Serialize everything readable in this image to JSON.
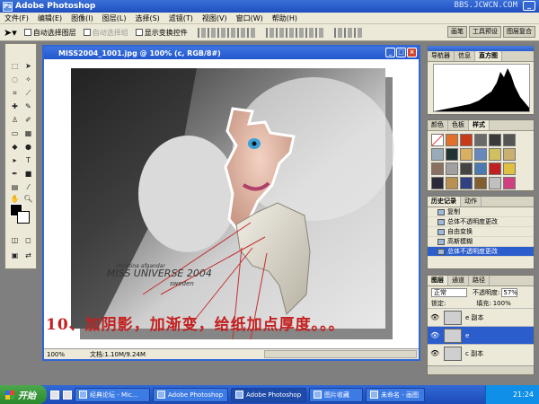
{
  "app": {
    "title": "Adobe Photoshop",
    "watermark": "BBS.JCWCN.COM"
  },
  "menu": [
    "文件(F)",
    "编辑(E)",
    "图像(I)",
    "图层(L)",
    "选择(S)",
    "滤镜(T)",
    "视图(V)",
    "窗口(W)",
    "帮助(H)"
  ],
  "options": {
    "auto_select_layer": "自动选择图层",
    "auto_select_group": "自动选择组",
    "show_transform": "显示变换控件",
    "palette_tabs": [
      "画笔",
      "工具预设",
      "图层复合"
    ]
  },
  "document": {
    "title": "MISS2004_1001.jpg @ 100% (c, RGB/8#)",
    "zoom": "100%",
    "doc_size": "文档:1.10M/9.24M",
    "caption": "10、加阴影，加渐变，给纸加点厚度。。。",
    "image_text_line1": "MISS UNIVERSE 2004",
    "image_text_line2": "sweden"
  },
  "panels": {
    "histogram": {
      "tabs": [
        "导航器",
        "信息",
        "直方图"
      ]
    },
    "styles": {
      "tabs": [
        "颜色",
        "色板",
        "样式"
      ]
    },
    "history": {
      "tabs": [
        "历史记录",
        "动作"
      ],
      "items": [
        "复制",
        "总体不透明度更改",
        "自由变换",
        "高斯模糊",
        "总体不透明度更改"
      ],
      "selected": 4
    },
    "layers": {
      "tabs": [
        "图层",
        "通道",
        "路径"
      ],
      "blend_mode": "正常",
      "opacity_label": "不透明度:",
      "opacity": "57%",
      "lock_label": "锁定:",
      "fill_label": "填充:",
      "fill": "100%",
      "layers": [
        {
          "name": "e 副本",
          "selected": false
        },
        {
          "name": "e",
          "selected": true
        },
        {
          "name": "c 副本",
          "selected": false
        }
      ]
    }
  },
  "taskbar": {
    "start": "开始",
    "tasks": [
      "经典论坛 - Mic...",
      "Adobe Photoshop",
      "Adobe Photoshop",
      "图片收藏",
      "未命名 - 画图"
    ],
    "active_task": 2,
    "clock": "21:24"
  },
  "colors": {
    "accent": "#2c5dcc",
    "caption": "#c42020",
    "start": "#3da83a"
  }
}
